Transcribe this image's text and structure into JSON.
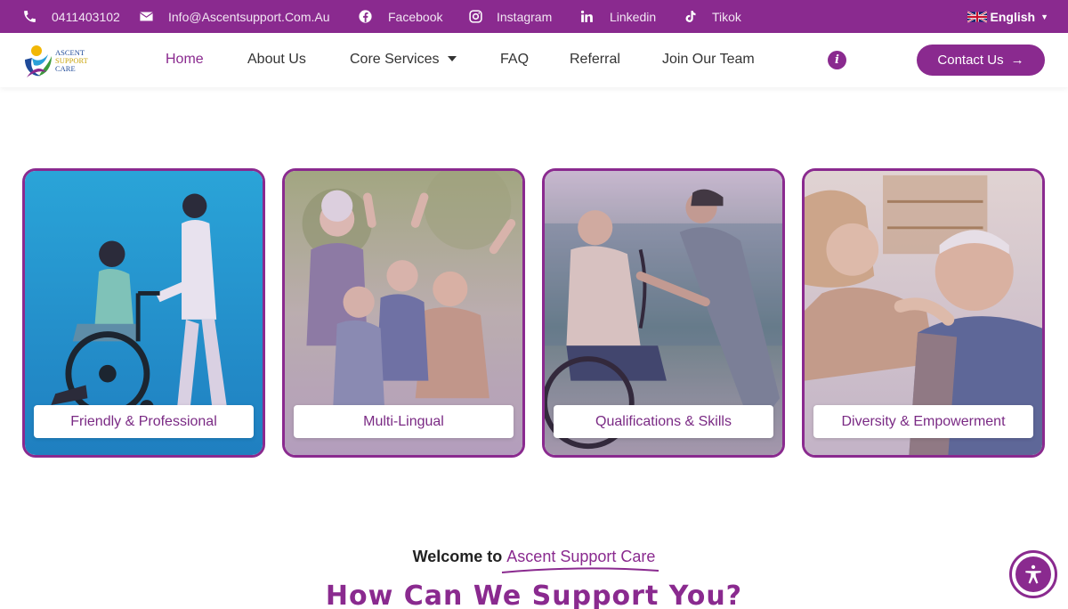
{
  "topbar": {
    "phone": "0411403102",
    "email": "Info@Ascentsupport.Com.Au",
    "facebook": "Facebook",
    "instagram": "Instagram",
    "linkedin": "Linkedin",
    "tiktok": "Tikok",
    "language": "English"
  },
  "logo": {
    "line1": "ASCENT",
    "line2": "SUPPORT",
    "line3": "CARE"
  },
  "nav": {
    "items": [
      "Home",
      "About Us",
      "Core Services",
      "FAQ",
      "Referral",
      "Join Our Team"
    ],
    "contact_label": "Contact Us",
    "contact_arrow": "→",
    "info_icon": "i"
  },
  "cards": [
    {
      "label": "Friendly & Professional"
    },
    {
      "label": "Multi-Lingual"
    },
    {
      "label": "Qualifications & Skills"
    },
    {
      "label": "Diversity & Empowerment"
    }
  ],
  "welcome": {
    "prefix": "Welcome to ",
    "brand": "Ascent Support Care",
    "headline": "How Can We Support You?"
  },
  "colors": {
    "brand": "#8a2a8f"
  }
}
